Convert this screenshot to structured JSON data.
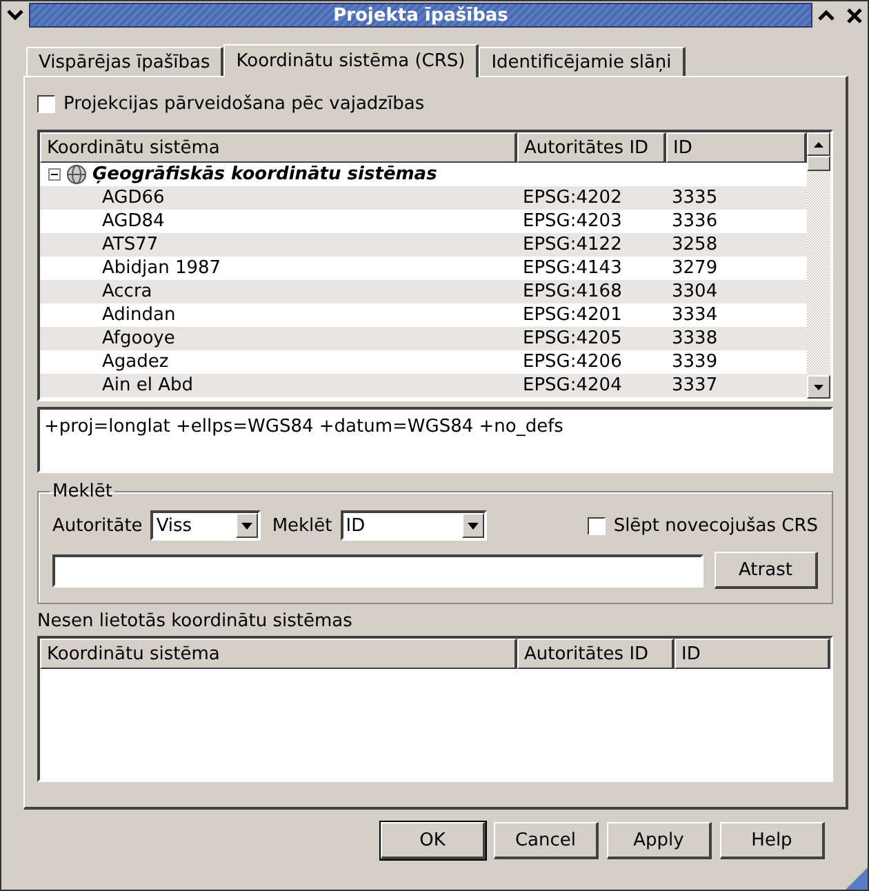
{
  "window": {
    "title": "Projekta īpašības"
  },
  "tabs": [
    {
      "label": "Vispārējas īpašības",
      "selected": false
    },
    {
      "label": "Koordinātu sistēma (CRS)",
      "selected": true
    },
    {
      "label": "Identificējamie slāņi",
      "selected": false
    }
  ],
  "projection_checkbox": {
    "label": "Projekcijas pārveidošana pēc vajadzības",
    "checked": false
  },
  "crs_table": {
    "columns": [
      "Koordinātu sistēma",
      "Autoritātes ID",
      "ID"
    ],
    "tree": [
      {
        "name": "Ģeogrāfiskās koordinātu sistēmas",
        "expanded": true,
        "children": [
          {
            "name": "AGD66",
            "authority_id": "EPSG:4202",
            "id": "3335"
          },
          {
            "name": "AGD84",
            "authority_id": "EPSG:4203",
            "id": "3336"
          },
          {
            "name": "ATS77",
            "authority_id": "EPSG:4122",
            "id": "3258"
          },
          {
            "name": "Abidjan 1987",
            "authority_id": "EPSG:4143",
            "id": "3279"
          },
          {
            "name": "Accra",
            "authority_id": "EPSG:4168",
            "id": "3304"
          },
          {
            "name": "Adindan",
            "authority_id": "EPSG:4201",
            "id": "3334"
          },
          {
            "name": "Afgooye",
            "authority_id": "EPSG:4205",
            "id": "3338"
          },
          {
            "name": "Agadez",
            "authority_id": "EPSG:4206",
            "id": "3339"
          },
          {
            "name": "Ain el Abd",
            "authority_id": "EPSG:4204",
            "id": "3337"
          }
        ]
      }
    ]
  },
  "proj_string": "+proj=longlat +ellps=WGS84 +datum=WGS84 +no_defs",
  "search": {
    "title": "Meklēt",
    "authority_label": "Autoritāte",
    "authority_value": "Viss",
    "search_label": "Meklēt",
    "search_value": "ID",
    "hide_deprecated": {
      "label": "Slēpt novecojušas CRS",
      "checked": false
    },
    "find_button": "Atrast"
  },
  "recent": {
    "title": "Nesen lietotās koordinātu sistēmas",
    "columns": [
      "Koordinātu sistēma",
      "Autoritātes ID",
      "ID"
    ]
  },
  "buttons": [
    {
      "label": "OK",
      "default": true
    },
    {
      "label": "Cancel",
      "default": false
    },
    {
      "label": "Apply",
      "default": false
    },
    {
      "label": "Help",
      "default": false
    }
  ]
}
